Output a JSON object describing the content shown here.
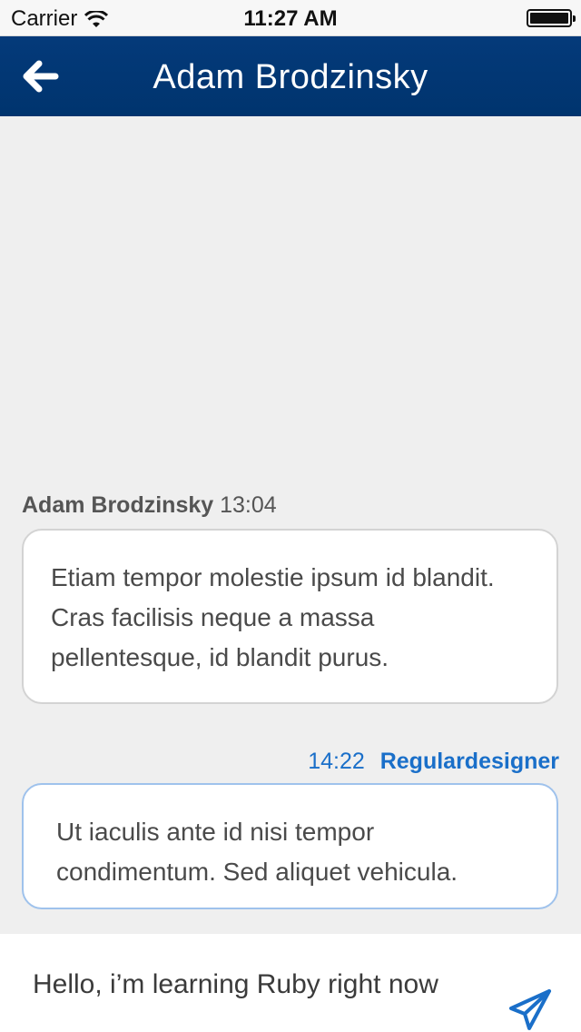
{
  "status_bar": {
    "carrier": "Carrier",
    "time": "11:27 AM"
  },
  "nav": {
    "title": "Adam Brodzinsky",
    "back_icon": "arrow-left-icon"
  },
  "messages": [
    {
      "sender": "Adam Brodzinsky",
      "time": "13:04",
      "text": "Etiam tempor molestie ipsum id blandit. Cras facilisis neque a massa pellentesque, id blandit purus.",
      "side": "left"
    },
    {
      "sender": "Regulardesigner",
      "time": "14:22",
      "text": "Ut iaculis ante id nisi tempor condimentum. Sed aliquet vehicula.",
      "side": "right"
    }
  ],
  "compose": {
    "value": "Hello, i’m learning Ruby right now",
    "send_icon": "paper-plane-icon"
  },
  "colors": {
    "nav_bg": "#00346e",
    "accent": "#1a6fc9",
    "background": "#efefef"
  }
}
